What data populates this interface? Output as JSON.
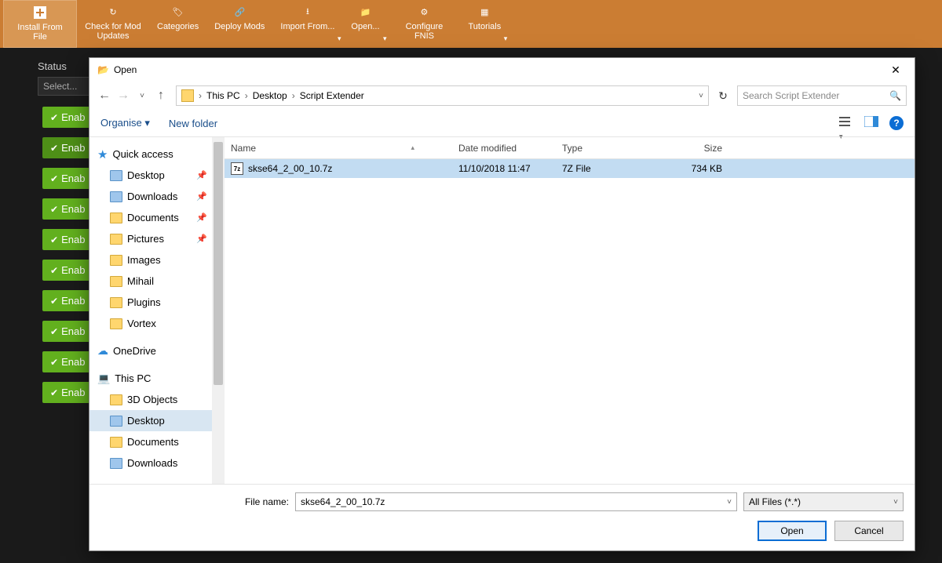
{
  "toolbar": {
    "items": [
      {
        "label": "Install From File"
      },
      {
        "label": "Check for Mod Updates"
      },
      {
        "label": "Categories"
      },
      {
        "label": "Deploy Mods"
      },
      {
        "label": "Import From...",
        "caret": true
      },
      {
        "label": "Open...",
        "caret": true
      },
      {
        "label": "Configure FNIS"
      },
      {
        "label": "Tutorials",
        "caret": true
      }
    ]
  },
  "bg": {
    "status_label": "Status",
    "select_placeholder": "Select...",
    "enab_label": "Enab"
  },
  "dialog": {
    "title": "Open",
    "breadcrumbs": [
      "This PC",
      "Desktop",
      "Script Extender"
    ],
    "search_placeholder": "Search Script Extender",
    "organise": "Organise",
    "new_folder": "New folder",
    "columns": {
      "name": "Name",
      "date": "Date modified",
      "type": "Type",
      "size": "Size"
    },
    "tree": {
      "quick_access": "Quick access",
      "qa_items": [
        {
          "label": "Desktop",
          "pin": true,
          "blue": true
        },
        {
          "label": "Downloads",
          "pin": true,
          "blue": true
        },
        {
          "label": "Documents",
          "pin": true
        },
        {
          "label": "Pictures",
          "pin": true
        },
        {
          "label": "Images"
        },
        {
          "label": "Mihail"
        },
        {
          "label": "Plugins"
        },
        {
          "label": "Vortex"
        }
      ],
      "onedrive": "OneDrive",
      "this_pc": "This PC",
      "pc_items": [
        {
          "label": "3D Objects"
        },
        {
          "label": "Desktop",
          "selected": true,
          "blue": true
        },
        {
          "label": "Documents"
        },
        {
          "label": "Downloads",
          "blue": true
        }
      ]
    },
    "files": [
      {
        "name": "skse64_2_00_10.7z",
        "date": "11/10/2018 11:47",
        "type": "7Z File",
        "size": "734 KB",
        "selected": true
      }
    ],
    "filename_label": "File name:",
    "filename_value": "skse64_2_00_10.7z",
    "filter": "All Files (*.*)",
    "open_btn": "Open",
    "cancel_btn": "Cancel"
  }
}
